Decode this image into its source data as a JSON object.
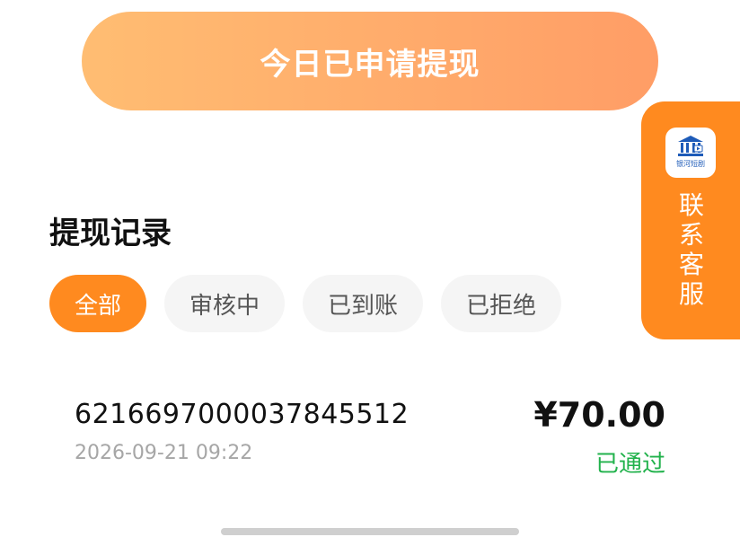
{
  "apply_button": {
    "label": "今日已申请提现"
  },
  "customer_service": {
    "logo_text": "银河短剧",
    "label": "联系客服",
    "logo_icon": "bank-building-icon"
  },
  "records": {
    "title": "提现记录",
    "filters": [
      {
        "label": "全部",
        "active": true
      },
      {
        "label": "审核中",
        "active": false
      },
      {
        "label": "已到账",
        "active": false
      },
      {
        "label": "已拒绝",
        "active": false
      }
    ],
    "items": [
      {
        "account": "6216697000037845512",
        "time": "2026-09-21 09:22",
        "amount": "¥70.00",
        "status": "已通过"
      }
    ]
  },
  "colors": {
    "accent": "#ff8a1f",
    "button_gradient_start": "#ffbd72",
    "button_gradient_end": "#ff9d66",
    "status_success": "#22b24c"
  }
}
